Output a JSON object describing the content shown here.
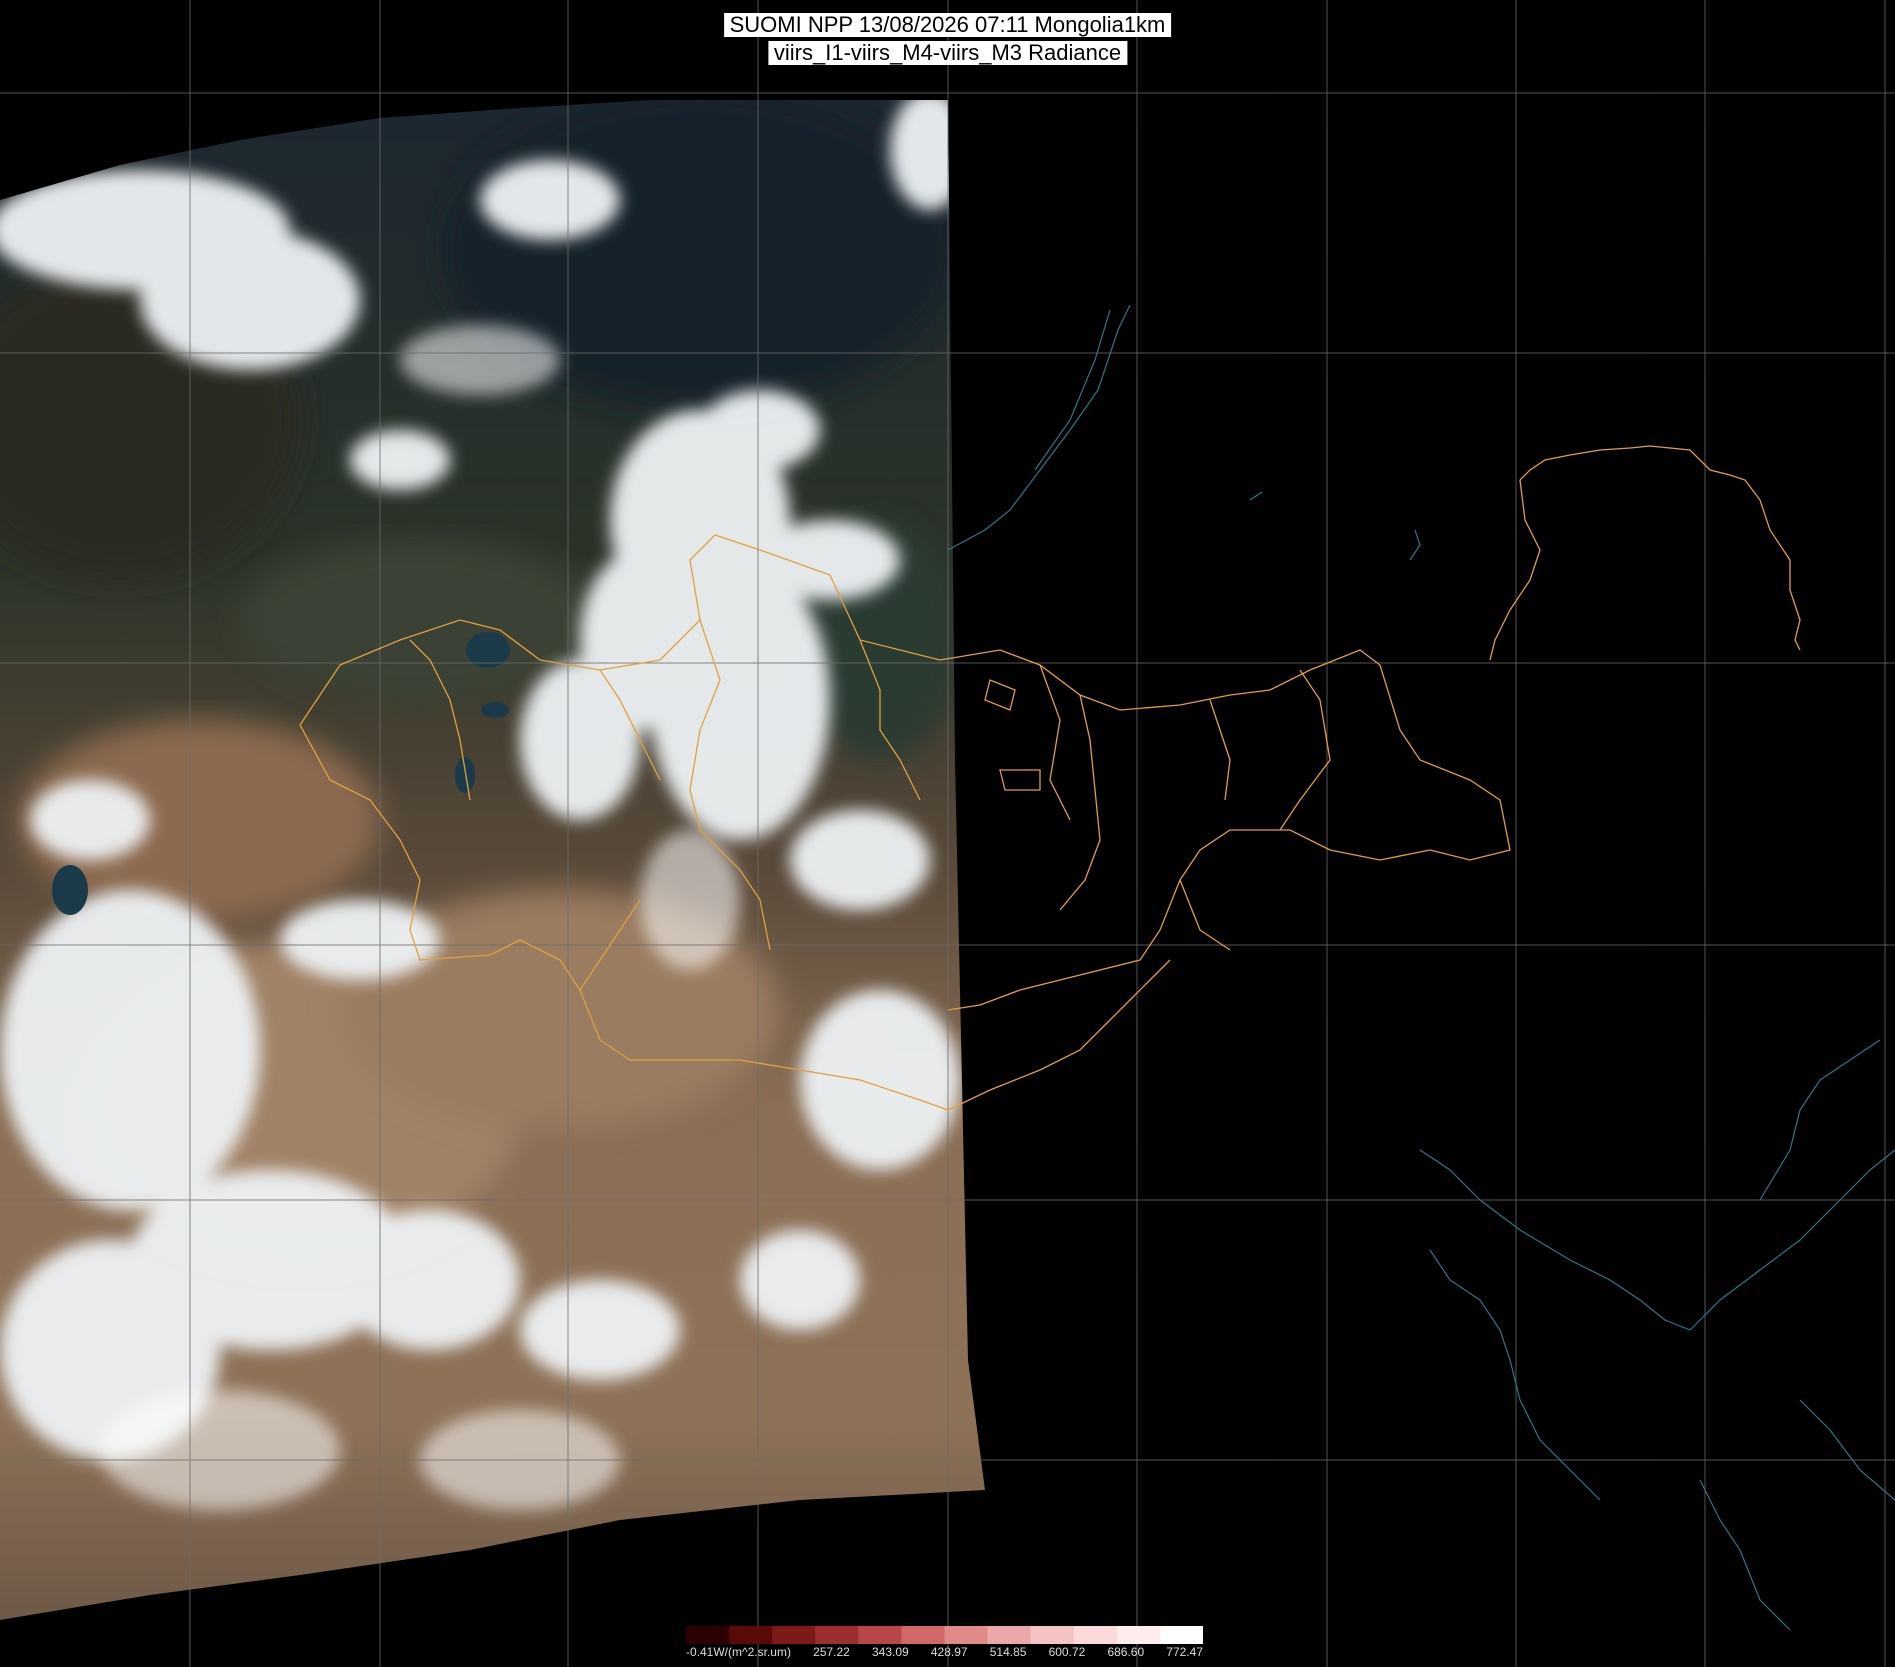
{
  "title": {
    "line1": "SUOMI NPP 13/08/2026 07:11 Mongolia1km",
    "line2": "viirs_I1-viirs_M4-viirs_M3 Radiance"
  },
  "colorbar": {
    "labels": [
      "-0.41W/(m^2.sr.um)",
      "257.22",
      "343.09",
      "428.97",
      "514.85",
      "600.72",
      "686.60",
      "772.47"
    ],
    "colors": [
      "#2a0000",
      "#5a0a0a",
      "#7c1a1a",
      "#9c2e2e",
      "#b84848",
      "#d06868",
      "#e08a8a",
      "#eca8a8",
      "#f4c4c4",
      "#fadada",
      "#ffeded",
      "#ffffff"
    ]
  },
  "map": {
    "background": "#000000",
    "grid_color": "#6b6b6b",
    "border_color": "#e0a040",
    "coast_color": "#2a7a8a",
    "imagery_colors": {
      "cloud": "#eef2f4",
      "forest": "#1f2a22",
      "desert": "#8a6e55",
      "steppe": "#6a5a48"
    }
  }
}
